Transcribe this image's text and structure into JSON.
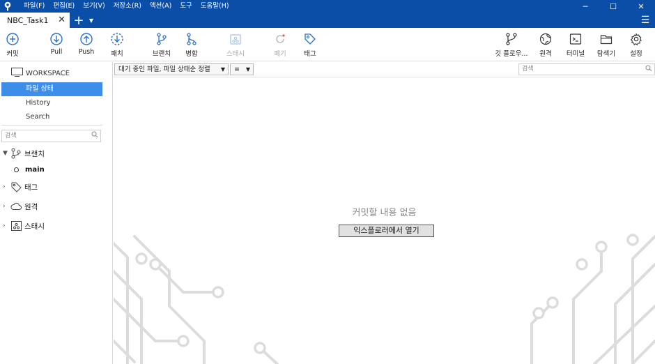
{
  "menu": [
    "파일(F)",
    "편집(E)",
    "보기(V)",
    "저장소(R)",
    "액션(A)",
    "도구",
    "도움말(H)"
  ],
  "window_controls": {
    "minimize": "─",
    "maximize": "☐",
    "close": "✕"
  },
  "tab": {
    "label": "NBC_Task1",
    "close": "✕",
    "add": "+",
    "dropdown": "▼",
    "menu": "☰"
  },
  "toolbar": {
    "commit": "커밋",
    "pull": "Pull",
    "push": "Push",
    "patch": "패치",
    "branch": "브랜치",
    "merge": "병합",
    "stash": "스태시",
    "discard": "폐기",
    "tag": "태그",
    "git_flow": "깃 플로우...",
    "remote": "원격",
    "terminal": "터미널",
    "explorer": "탐색기",
    "settings": "설정"
  },
  "sidebar": {
    "workspace": "WORKSPACE",
    "nav": [
      "파일 상태",
      "History",
      "Search"
    ],
    "search_placeholder": "검색",
    "branches": "브랜치",
    "current_branch": "main",
    "tags": "태그",
    "remotes": "원격",
    "stashes": "스태시"
  },
  "main": {
    "filter_select": "대기 중인 파일, 파일 상태순 정렬",
    "view_select": "≡",
    "search_placeholder": "검색",
    "empty_text": "커밋할 내용 없음",
    "open_explorer": "익스플로러에서 열기"
  },
  "colors": {
    "titlebar": "#0a4ea8",
    "selected": "#3d8ee8",
    "toolbar_icon": "#2a6fc9"
  }
}
